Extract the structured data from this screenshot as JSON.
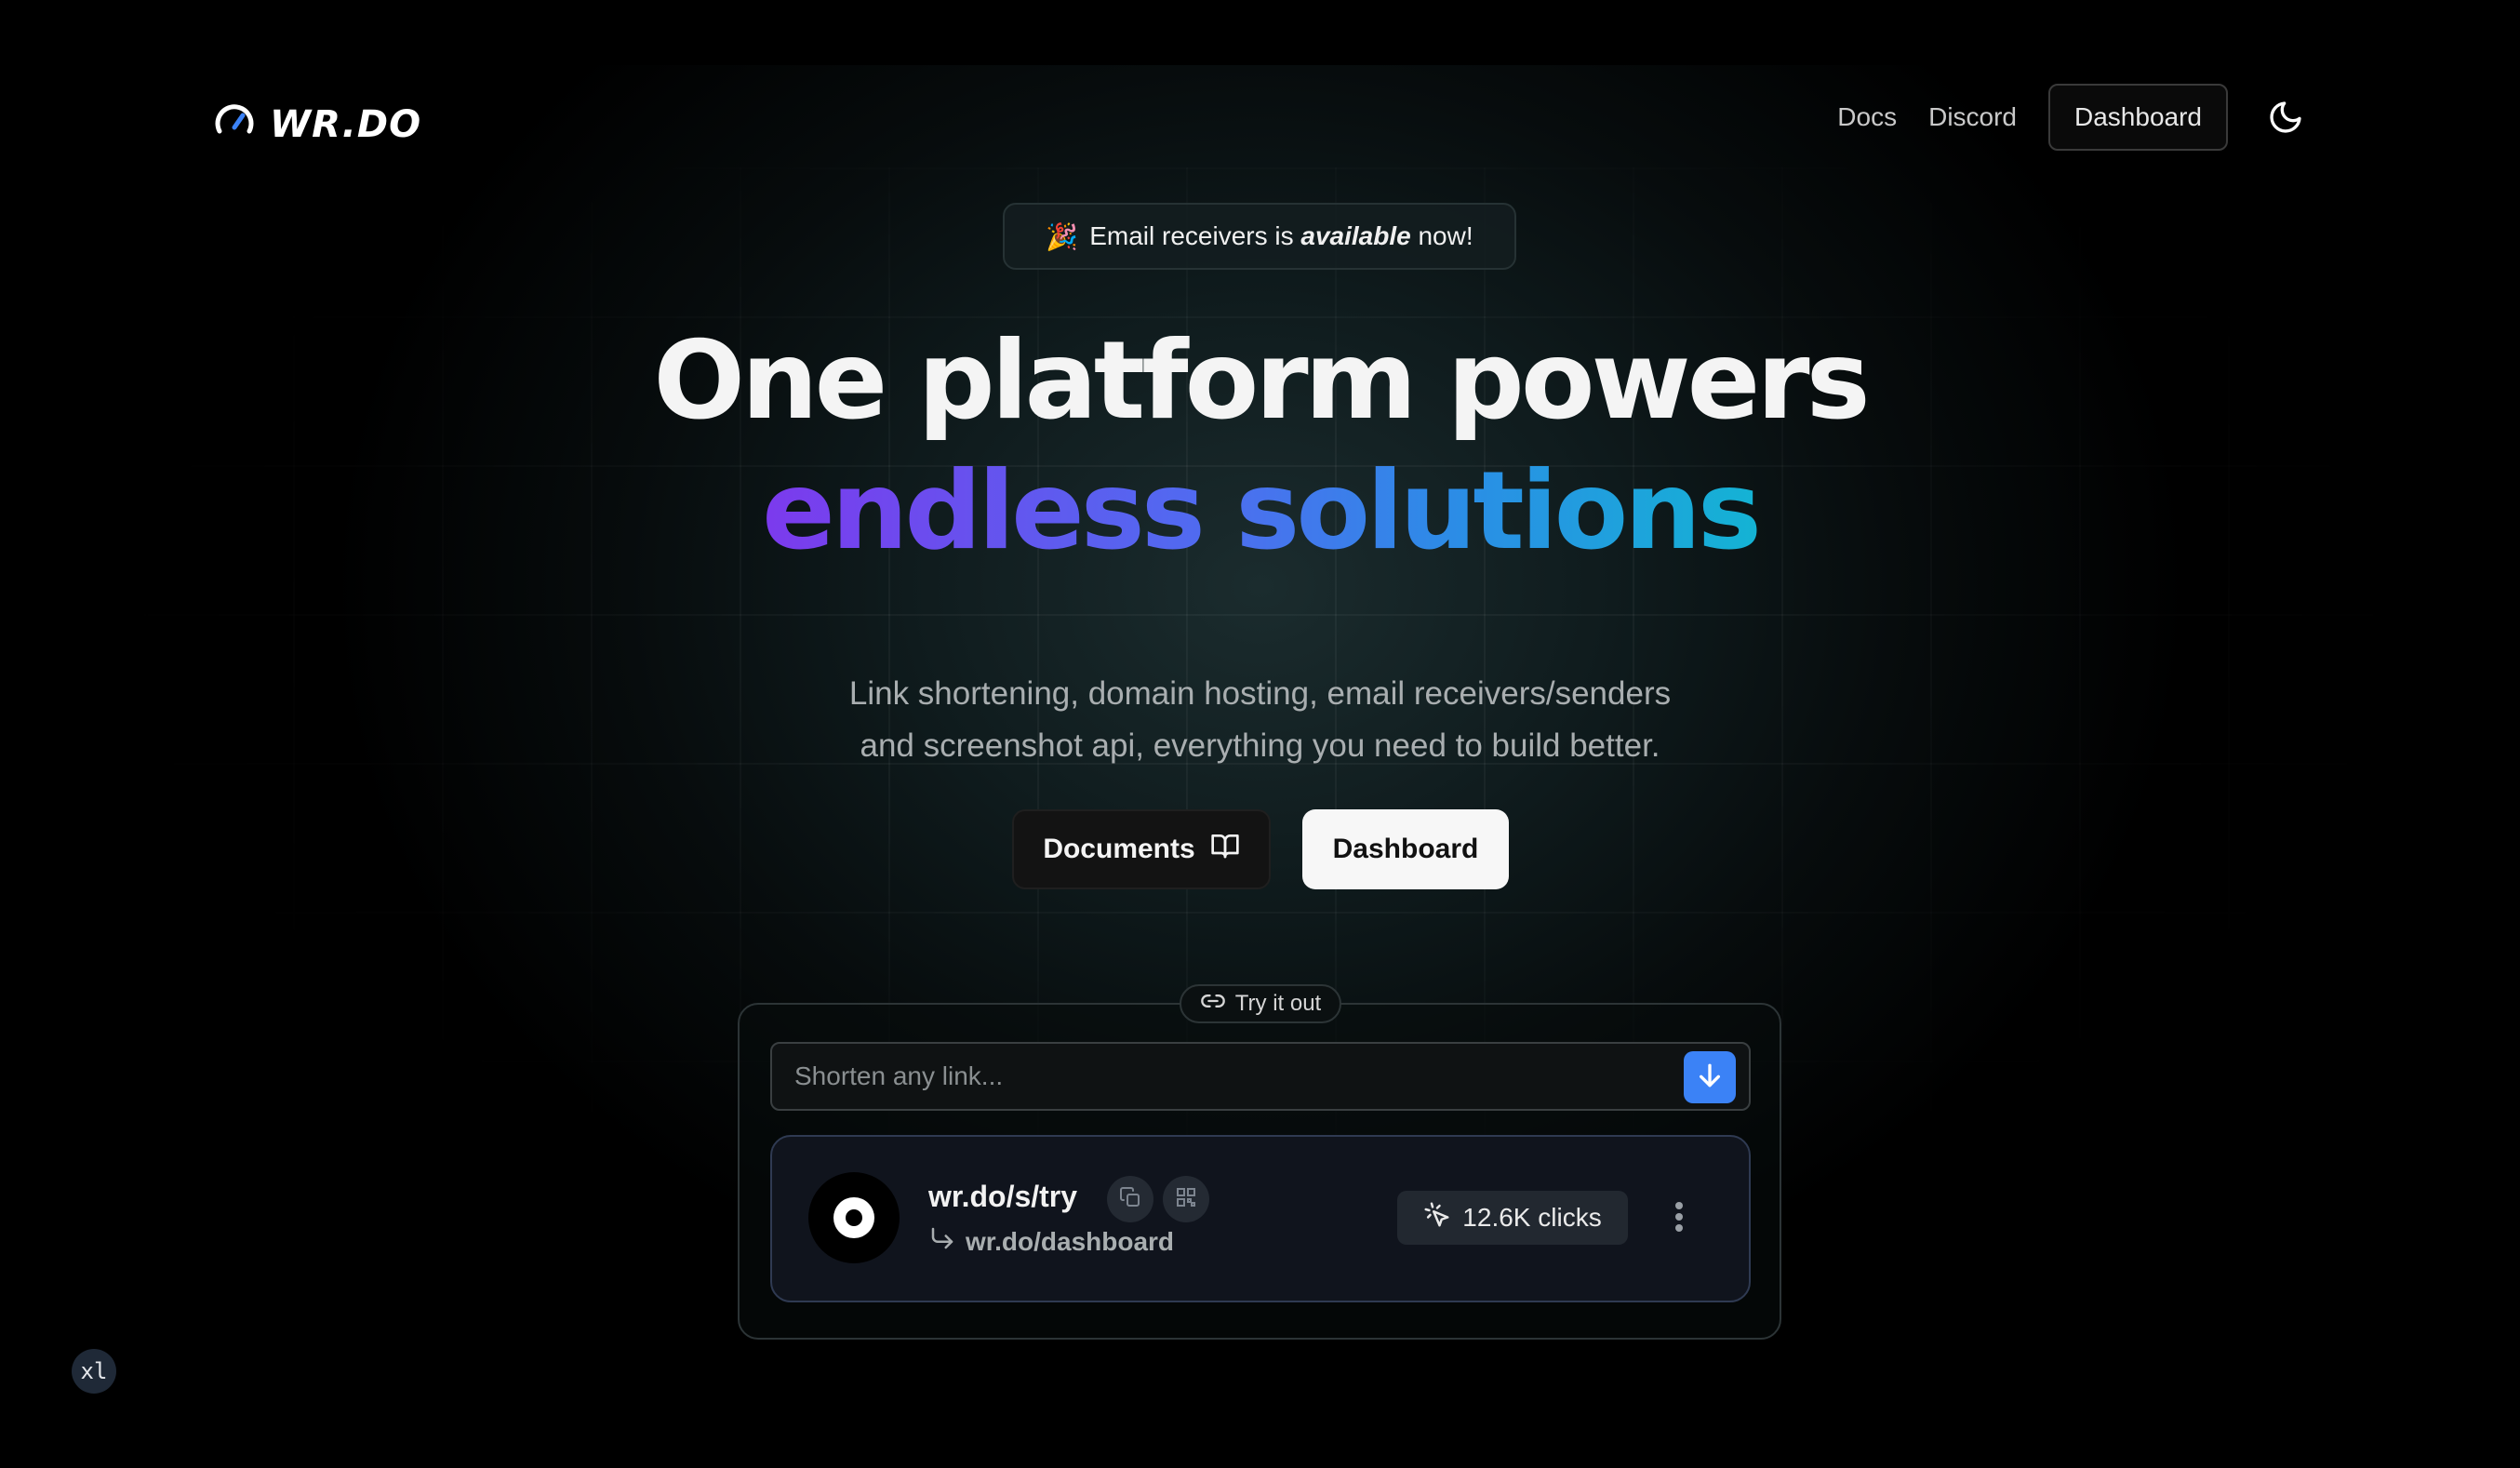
{
  "header": {
    "logo_text": "WR.DO",
    "nav": {
      "docs": "Docs",
      "discord": "Discord",
      "dashboard": "Dashboard"
    },
    "theme_icon": "moon-icon"
  },
  "announcement": {
    "emoji": "🎉",
    "prefix": "Email receivers is ",
    "emphasis": "available",
    "suffix": " now!"
  },
  "hero": {
    "line1": "One platform powers",
    "line2": "endless solutions",
    "subtitle_line1": "Link shortening, domain hosting, email receivers/senders",
    "subtitle_line2": "and screenshot api, everything you need to build better.",
    "cta_docs": "Documents",
    "cta_dashboard": "Dashboard"
  },
  "try_it": {
    "pill_label": "Try it out",
    "input_placeholder": "Shorten any link...",
    "input_value": "",
    "submit_icon": "arrow-down-icon",
    "result": {
      "short_url": "wr.do/s/try",
      "destination": "wr.do/dashboard",
      "clicks": "12.6K clicks"
    }
  },
  "badge": {
    "breakpoint": "xl"
  },
  "colors": {
    "accent_blue": "#3b82f6",
    "gradient_start": "#7c3aed",
    "gradient_end": "#14b3d4"
  }
}
